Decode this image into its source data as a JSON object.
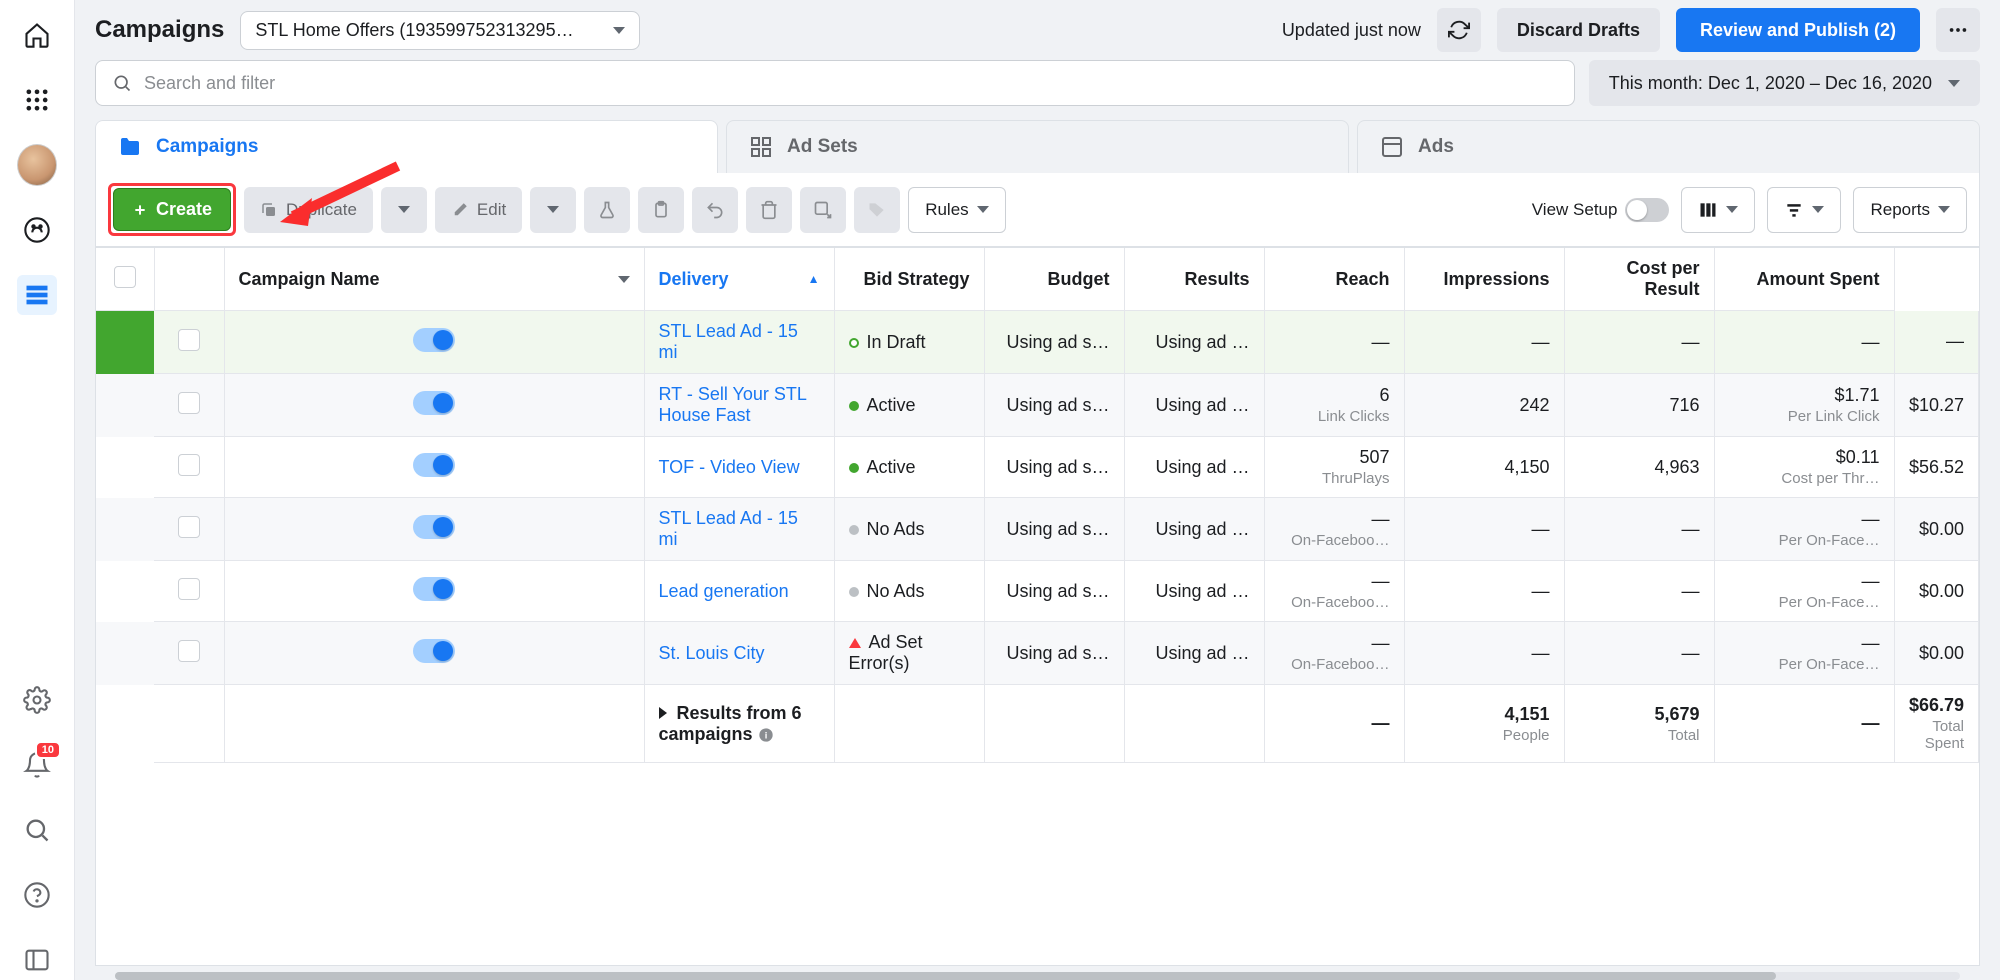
{
  "header": {
    "title": "Campaigns",
    "account": "STL Home Offers (193599752313295…",
    "updated": "Updated just now",
    "discard": "Discard Drafts",
    "publish": "Review and Publish (2)"
  },
  "search": {
    "placeholder": "Search and filter",
    "dateRange": "This month: Dec 1, 2020 – Dec 16, 2020"
  },
  "tabs": {
    "campaigns": "Campaigns",
    "adsets": "Ad Sets",
    "ads": "Ads"
  },
  "toolbar": {
    "create": "Create",
    "duplicate": "Duplicate",
    "edit": "Edit",
    "rules": "Rules",
    "viewSetup": "View Setup",
    "reports": "Reports"
  },
  "columns": {
    "name": "Campaign Name",
    "delivery": "Delivery",
    "bid": "Bid Strategy",
    "budget": "Budget",
    "results": "Results",
    "reach": "Reach",
    "impressions": "Impressions",
    "cpr": "Cost per Result",
    "spent": "Amount Spent"
  },
  "rows": [
    {
      "name": "STL Lead Ad - 15 mi",
      "statusLabel": "In Draft",
      "statusType": "draft",
      "bid": "Using ad s…",
      "budget": "Using ad …",
      "results": "—",
      "resultsSub": "",
      "reach": "—",
      "impressions": "—",
      "cpr": "—",
      "cprSub": "",
      "spent": "—",
      "highlight": true
    },
    {
      "name": "RT - Sell Your STL House Fast",
      "statusLabel": "Active",
      "statusType": "active",
      "bid": "Using ad s…",
      "budget": "Using ad …",
      "results": "6",
      "resultsSub": "Link Clicks",
      "reach": "242",
      "impressions": "716",
      "cpr": "$1.71",
      "cprSub": "Per Link Click",
      "spent": "$10.27",
      "alt": true
    },
    {
      "name": "TOF - Video View",
      "statusLabel": "Active",
      "statusType": "active",
      "bid": "Using ad s…",
      "budget": "Using ad …",
      "results": "507",
      "resultsSub": "ThruPlays",
      "reach": "4,150",
      "impressions": "4,963",
      "cpr": "$0.11",
      "cprSub": "Cost per Thr…",
      "spent": "$56.52"
    },
    {
      "name": "STL Lead Ad - 15 mi",
      "statusLabel": "No Ads",
      "statusType": "grey",
      "bid": "Using ad s…",
      "budget": "Using ad …",
      "results": "—",
      "resultsSub": "On-Faceboo…",
      "reach": "—",
      "impressions": "—",
      "cpr": "—",
      "cprSub": "Per On-Face…",
      "spent": "$0.00",
      "alt": true
    },
    {
      "name": "Lead generation",
      "statusLabel": "No Ads",
      "statusType": "grey",
      "bid": "Using ad s…",
      "budget": "Using ad …",
      "results": "—",
      "resultsSub": "On-Faceboo…",
      "reach": "—",
      "impressions": "—",
      "cpr": "—",
      "cprSub": "Per On-Face…",
      "spent": "$0.00"
    },
    {
      "name": "St. Louis City",
      "statusLabel": "Ad Set Error(s)",
      "statusType": "error",
      "bid": "Using ad s…",
      "budget": "Using ad …",
      "results": "—",
      "resultsSub": "On-Faceboo…",
      "reach": "—",
      "impressions": "—",
      "cpr": "—",
      "cprSub": "Per On-Face…",
      "spent": "$0.00",
      "alt": true
    }
  ],
  "summary": {
    "label": "Results from 6 campaigns",
    "results": "—",
    "reach": "4,151",
    "reachSub": "People",
    "impressions": "5,679",
    "impressionsSub": "Total",
    "cpr": "—",
    "spent": "$66.79",
    "spentSub": "Total Spent"
  },
  "sidebar": {
    "notifCount": "10"
  }
}
